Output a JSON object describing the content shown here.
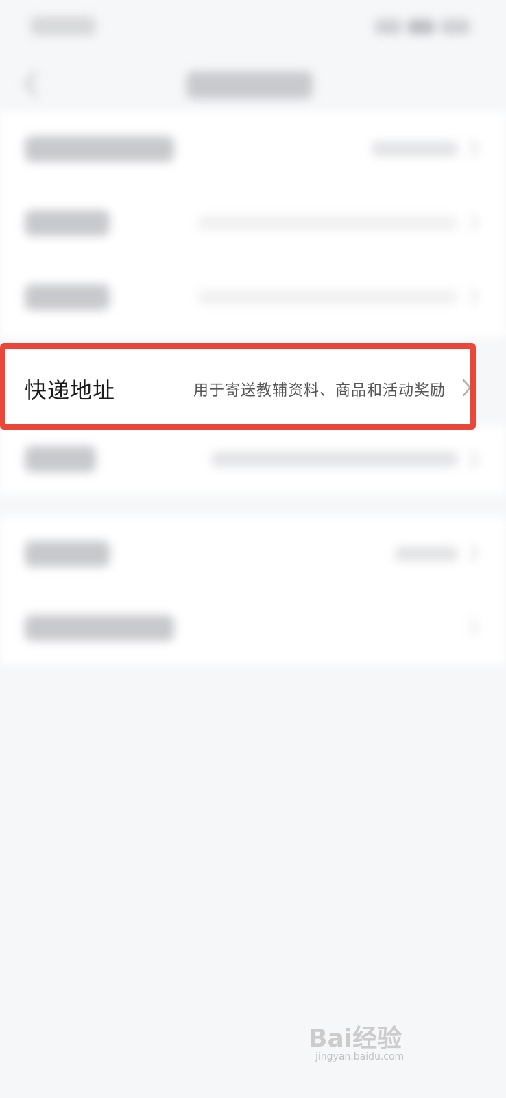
{
  "highlight": {
    "label": "快递地址",
    "value": "用于寄送教辅资料、商品和活动奖励"
  },
  "watermark": {
    "brand": "Bai经验",
    "url": "jingyan.baidu.com"
  },
  "colors": {
    "highlight_border": "#e8473a",
    "background": "#f6f7f9"
  }
}
